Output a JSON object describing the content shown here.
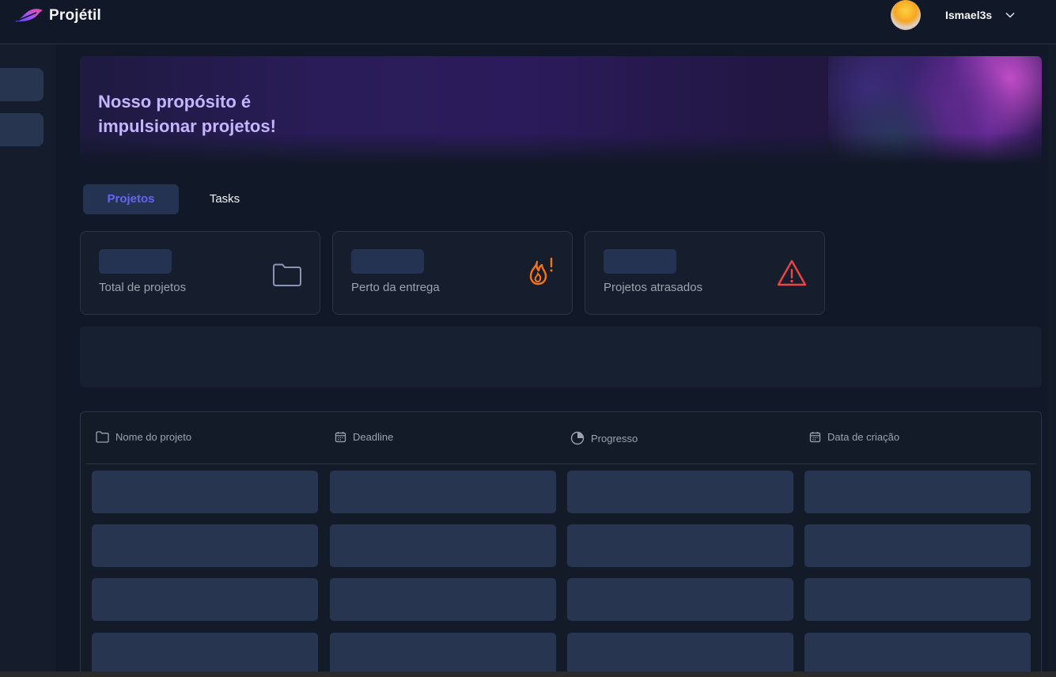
{
  "app": {
    "name": "Projétil"
  },
  "user": {
    "name": "Ismael3s"
  },
  "hero": {
    "title": "Nosso propósito é impulsionar projetos!"
  },
  "tabs": [
    {
      "label": "Projetos",
      "active": true
    },
    {
      "label": "Tasks",
      "active": false
    }
  ],
  "stats": [
    {
      "label": "Total de projetos",
      "icon": "folder-icon"
    },
    {
      "label": "Perto da entrega",
      "icon": "fire-alert-icon",
      "color": "#f97316"
    },
    {
      "label": "Projetos atrasados",
      "icon": "warning-icon",
      "color": "#ef4444"
    }
  ],
  "table": {
    "columns": [
      {
        "label": "Nome do projeto",
        "icon": "folder-icon"
      },
      {
        "label": "Deadline",
        "icon": "calendar-icon"
      },
      {
        "label": "Progresso",
        "icon": "pie-chart-icon"
      },
      {
        "label": "Data de criação",
        "icon": "calendar-icon"
      }
    ]
  },
  "colors": {
    "accent": "#6366f1",
    "background": "#111827",
    "skeleton": "#283550"
  }
}
